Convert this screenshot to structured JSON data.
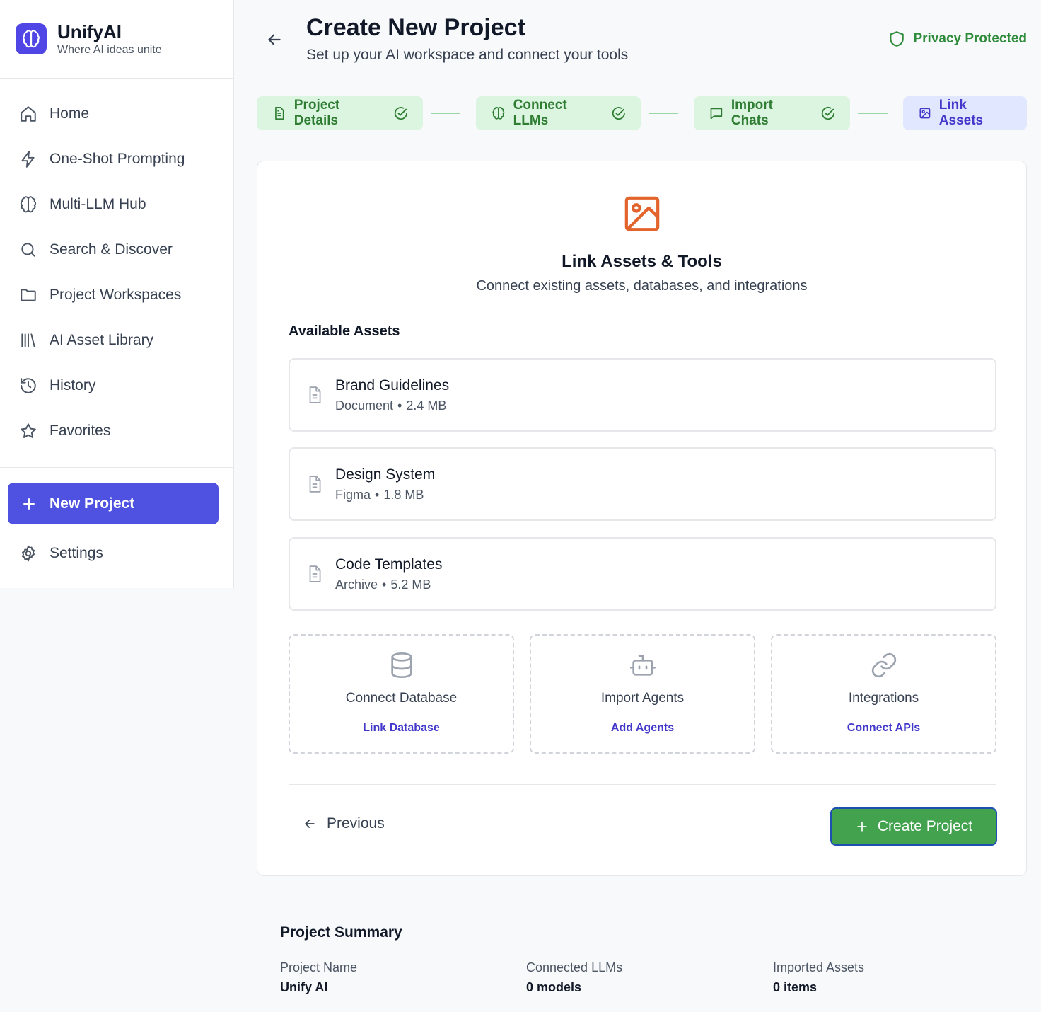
{
  "brand": {
    "name": "UnifyAI",
    "tagline": "Where AI ideas unite",
    "color": "#4f46e5"
  },
  "sidebar": {
    "items": [
      {
        "label": "Home",
        "icon": "home-icon"
      },
      {
        "label": "One-Shot Prompting",
        "icon": "lightning-icon"
      },
      {
        "label": "Multi-LLM Hub",
        "icon": "brain-icon"
      },
      {
        "label": "Search & Discover",
        "icon": "search-icon"
      },
      {
        "label": "Project Workspaces",
        "icon": "folder-icon"
      },
      {
        "label": "AI Asset Library",
        "icon": "library-icon"
      },
      {
        "label": "History",
        "icon": "history-icon"
      },
      {
        "label": "Favorites",
        "icon": "star-icon"
      }
    ],
    "new_project_label": "New Project",
    "settings_label": "Settings"
  },
  "header": {
    "title": "Create New Project",
    "subtitle": "Set up your AI workspace and connect your tools",
    "privacy_label": "Privacy Protected"
  },
  "steps": [
    {
      "label": "Project Details",
      "status": "done"
    },
    {
      "label": "Connect LLMs",
      "status": "done"
    },
    {
      "label": "Import Chats",
      "status": "done"
    },
    {
      "label": "Link Assets",
      "status": "active"
    }
  ],
  "card": {
    "title": "Link Assets & Tools",
    "subtitle": "Connect existing assets, databases, and integrations",
    "section_title": "Available Assets",
    "assets": [
      {
        "name": "Brand Guidelines",
        "type": "Document",
        "size": "2.4 MB"
      },
      {
        "name": "Design System",
        "type": "Figma",
        "size": "1.8 MB"
      },
      {
        "name": "Code Templates",
        "type": "Archive",
        "size": "5.2 MB"
      }
    ],
    "tools": [
      {
        "name": "Connect Database",
        "link": "Link Database",
        "icon": "database-icon"
      },
      {
        "name": "Import Agents",
        "link": "Add Agents",
        "icon": "robot-icon"
      },
      {
        "name": "Integrations",
        "link": "Connect APIs",
        "icon": "link-icon"
      }
    ],
    "previous_label": "Previous",
    "create_label": "Create Project"
  },
  "summary": {
    "title": "Project Summary",
    "fields": [
      {
        "label": "Project Name",
        "value": "Unify AI"
      },
      {
        "label": "Connected LLMs",
        "value": "0 models"
      },
      {
        "label": "Imported Assets",
        "value": "0 items"
      }
    ]
  },
  "colors": {
    "accent": "#4f52e0",
    "success": "#43a24e",
    "step_done_bg": "#dcf5e1",
    "step_active_bg": "#e0e7ff",
    "asset_icon": "#e2632b"
  }
}
